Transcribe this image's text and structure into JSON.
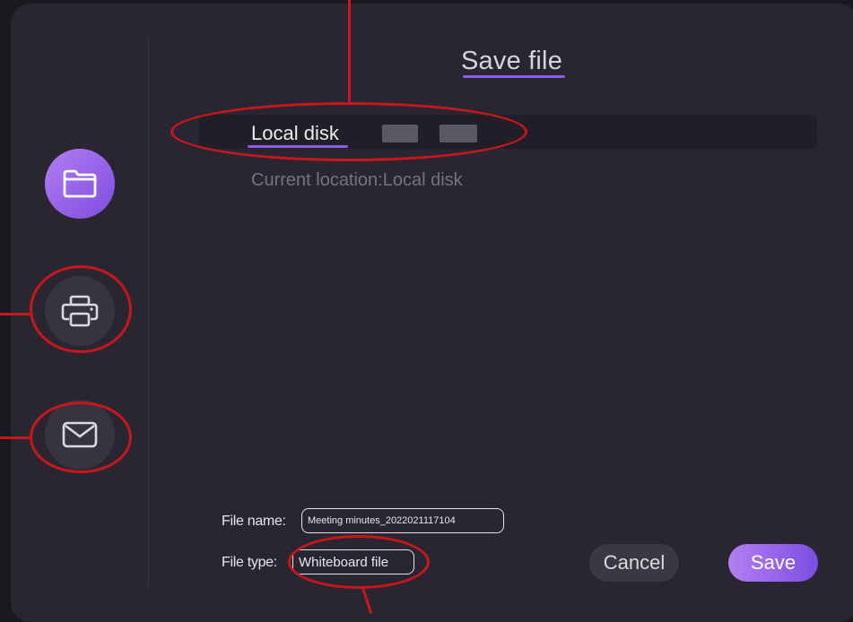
{
  "dialog": {
    "title": "Save file",
    "breadcrumb": "Local disk",
    "current_location": "Current location:Local disk"
  },
  "sidebar": {
    "items": [
      {
        "name": "folder",
        "icon": "folder-icon",
        "active": true
      },
      {
        "name": "print",
        "icon": "printer-icon",
        "active": false
      },
      {
        "name": "email",
        "icon": "mail-icon",
        "active": false
      }
    ]
  },
  "form": {
    "file_name_label": "File name:",
    "file_name_value": "Meeting minutes_2022021117104",
    "file_type_label": "File type:",
    "file_type_value": "Whiteboard file"
  },
  "actions": {
    "cancel_label": "Cancel",
    "save_label": "Save"
  },
  "colors": {
    "accent": "#8d5ce8",
    "annotation": "#c8161d",
    "panel_bg": "#2a2631"
  }
}
